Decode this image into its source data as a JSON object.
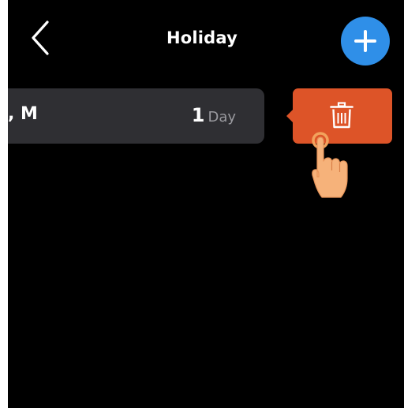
{
  "header": {
    "title": "Holiday",
    "back_icon": "chevron-left-icon",
    "add_icon": "plus-icon",
    "add_button_color": "#2f8fe8"
  },
  "holiday_list": {
    "items": [
      {
        "name": ", M",
        "duration_value": "1",
        "duration_unit": "Day"
      }
    ]
  },
  "swipe_action": {
    "icon": "trash-icon",
    "color": "#dd5428"
  },
  "overlay": {
    "icon": "tap-hand-icon"
  }
}
